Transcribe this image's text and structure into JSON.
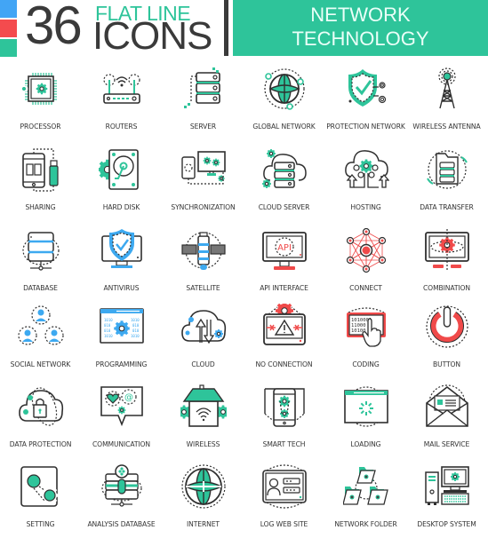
{
  "header": {
    "count": "36",
    "subtitle_top": "FLAT LINE",
    "subtitle_bottom": "ICONS",
    "banner_line1": "NETWORK",
    "banner_line2": "TECHNOLOGY",
    "swatches": [
      "#42a5f5",
      "#f44b4e",
      "#2ec49a"
    ],
    "banner_color": "#2ec49a",
    "dark_color": "#3a3a3a"
  },
  "palette": {
    "green": "#2ec49a",
    "blue": "#3da9f0",
    "red": "#f04a4a",
    "line": "#2f2f2f"
  },
  "icons": [
    {
      "label": "PROCESSOR",
      "icon": "processor-icon",
      "accent": "green"
    },
    {
      "label": "ROUTERS",
      "icon": "router-icon",
      "accent": "green"
    },
    {
      "label": "SERVER",
      "icon": "server-icon",
      "accent": "green"
    },
    {
      "label": "GLOBAL NETWORK",
      "icon": "globe-network-icon",
      "accent": "green"
    },
    {
      "label": "PROTECTION NETWORK",
      "icon": "shield-check-icon",
      "accent": "green"
    },
    {
      "label": "WIRELESS ANTENNA",
      "icon": "antenna-tower-icon",
      "accent": "green"
    },
    {
      "label": "SHARING",
      "icon": "phone-usb-sharing-icon",
      "accent": "green"
    },
    {
      "label": "HARD DISK",
      "icon": "hard-disk-icon",
      "accent": "green"
    },
    {
      "label": "SYNCHRONIZATION",
      "icon": "sync-devices-icon",
      "accent": "green"
    },
    {
      "label": "CLOUD SERVER",
      "icon": "cloud-server-icon",
      "accent": "green"
    },
    {
      "label": "HOSTING",
      "icon": "cloud-hosting-icon",
      "accent": "green"
    },
    {
      "label": "DATA TRANSFER",
      "icon": "data-transfer-icon",
      "accent": "green"
    },
    {
      "label": "DATABASE",
      "icon": "database-icon",
      "accent": "blue"
    },
    {
      "label": "ANTIVIRUS",
      "icon": "antivirus-monitor-icon",
      "accent": "blue"
    },
    {
      "label": "SATELLITE",
      "icon": "satellite-icon",
      "accent": "blue"
    },
    {
      "label": "API INTERFACE",
      "icon": "api-monitor-icon",
      "accent": "red"
    },
    {
      "label": "CONNECT",
      "icon": "connect-network-icon",
      "accent": "red"
    },
    {
      "label": "COMBINATION",
      "icon": "combination-gear-icon",
      "accent": "red"
    },
    {
      "label": "SOCIAL NETWORK",
      "icon": "social-network-icon",
      "accent": "blue"
    },
    {
      "label": "PROGRAMMING",
      "icon": "programming-window-icon",
      "accent": "blue"
    },
    {
      "label": "CLOUD",
      "icon": "cloud-sync-icon",
      "accent": "blue"
    },
    {
      "label": "NO CONNECTION",
      "icon": "no-connection-icon",
      "accent": "red"
    },
    {
      "label": "CODING",
      "icon": "coding-touch-icon",
      "accent": "red"
    },
    {
      "label": "BUTTON",
      "icon": "power-button-icon",
      "accent": "red"
    },
    {
      "label": "DATA PROTECTION",
      "icon": "cloud-lock-icon",
      "accent": "green"
    },
    {
      "label": "COMMUNICATION",
      "icon": "chat-bubble-icon",
      "accent": "green"
    },
    {
      "label": "WIRELESS",
      "icon": "wireless-house-icon",
      "accent": "green"
    },
    {
      "label": "SMART TECH",
      "icon": "smart-phone-gears-icon",
      "accent": "green"
    },
    {
      "label": "LOADING",
      "icon": "loading-window-icon",
      "accent": "green"
    },
    {
      "label": "MAIL SERVICE",
      "icon": "mail-envelope-icon",
      "accent": "green"
    },
    {
      "label": "SETTING",
      "icon": "settings-gears-icon",
      "accent": "green"
    },
    {
      "label": "ANALYSIS DATABASE",
      "icon": "analysis-database-icon",
      "accent": "green"
    },
    {
      "label": "INTERNET",
      "icon": "internet-globe-icon",
      "accent": "green"
    },
    {
      "label": "LOG WEB SITE",
      "icon": "login-website-icon",
      "accent": "green"
    },
    {
      "label": "NETWORK FOLDER",
      "icon": "network-folder-icon",
      "accent": "green"
    },
    {
      "label": "DESKTOP SYSTEM",
      "icon": "desktop-computer-icon",
      "accent": "green"
    }
  ]
}
